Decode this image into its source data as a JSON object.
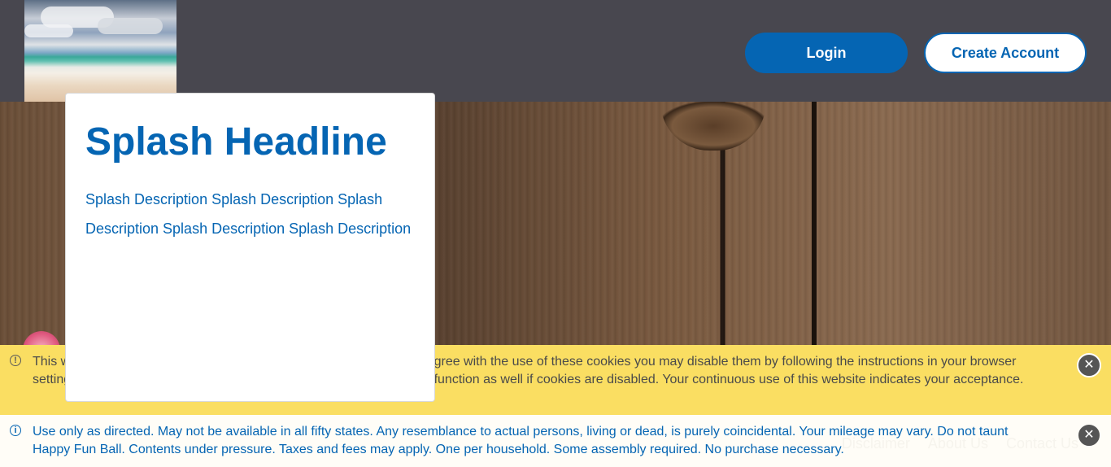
{
  "header": {
    "login_label": "Login",
    "create_account_label": "Create Account"
  },
  "splash": {
    "headline": "Splash Headline",
    "description": "Splash Description Splash Description Splash Description Splash Description Splash Description"
  },
  "cookie_banner": {
    "text": "This website uses cookies to improve your experience. If you do not agree with the use of these cookies you may disable them by following the instructions in your browser settings. Please be aware that some features of the services may not function as well if cookies are disabled. Your continuous use of this website indicates your acceptance.",
    "icon": "info-icon",
    "close_icon": "close-icon"
  },
  "disclaimer_banner": {
    "text": "Use only as directed. May not be available in all fifty states. Any resemblance to actual persons, living or dead, is purely coincidental. Your mileage may vary. Do not taunt Happy Fun Ball. Contents under pressure. Taxes and fees may apply. One per household. Some assembly required. No purchase necessary.",
    "icon": "info-icon",
    "close_icon": "close-icon"
  },
  "footer_links": [
    "Disclaimer",
    "About Us",
    "Contact Us"
  ],
  "colors": {
    "brand_blue": "#0565b3",
    "header_bg": "#48474f",
    "cookie_banner_bg": "#fade62",
    "disclaimer_bg": "#fffdf7"
  }
}
